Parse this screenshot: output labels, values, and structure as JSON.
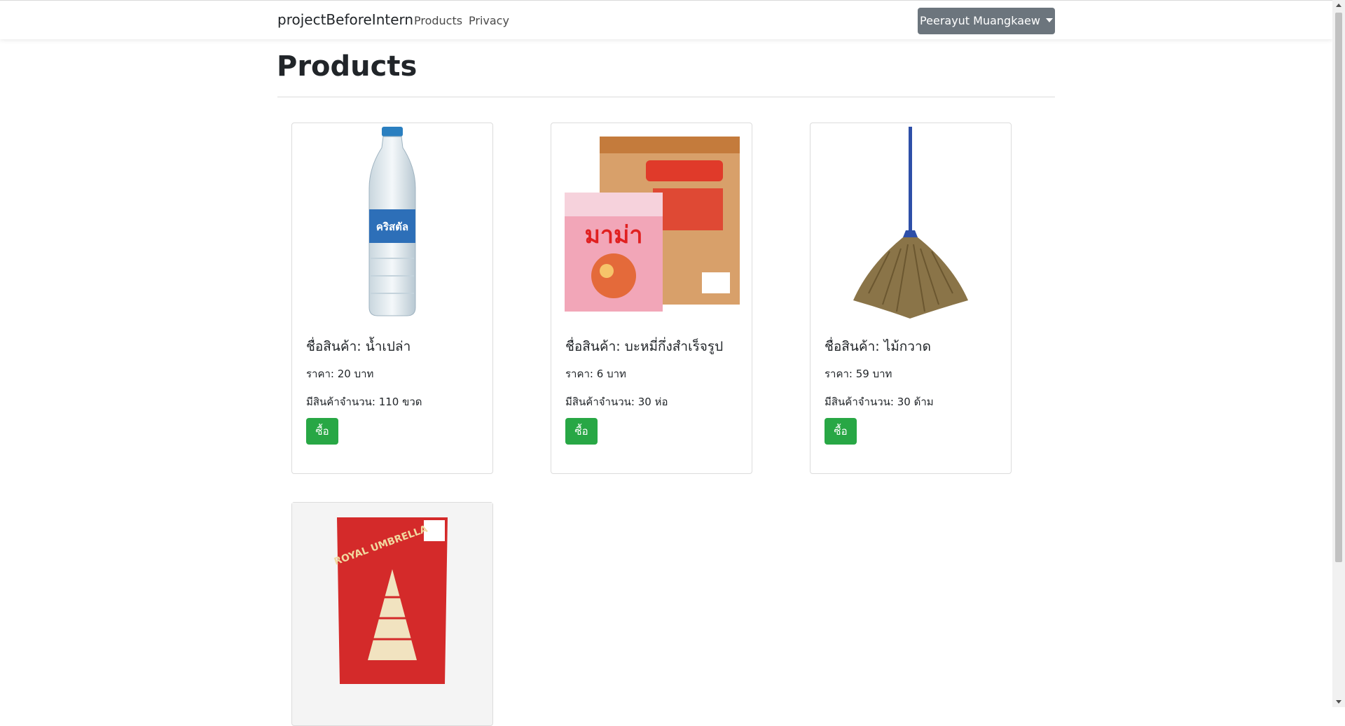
{
  "navbar": {
    "brand": "projectBeforeIntern",
    "links": [
      "Products",
      "Privacy"
    ],
    "user_button": "Peerayut Muangkaew"
  },
  "main": {
    "title": "Products"
  },
  "products": [
    {
      "name": "ชื่อสินค้า: น้ำเปล่า",
      "price": "ราคา: 20 บาท",
      "stock": "มีสินค้าจำนวน: 110 ขวด",
      "buy_label": "ซื้อ",
      "image_icon": "water-bottle-image"
    },
    {
      "name": "ชื่อสินค้า: บะหมี่กึ่งสำเร็จรูป",
      "price": "ราคา: 6 บาท",
      "stock": "มีสินค้าจำนวน: 30 ห่อ",
      "buy_label": "ซื้อ",
      "image_icon": "instant-noodles-image",
      "image_text": "มาม่า"
    },
    {
      "name": "ชื่อสินค้า: ไม้กวาด",
      "price": "ราคา: 59 บาท",
      "stock": "มีสินค้าจำนวน: 30 ด้าม",
      "buy_label": "ซื้อ",
      "image_icon": "broom-image"
    },
    {
      "image_icon": "rice-bag-image",
      "image_text": "ROYAL UMBRELLA"
    }
  ],
  "colors": {
    "buy_button": "#28a745",
    "user_button": "#6c757d"
  }
}
